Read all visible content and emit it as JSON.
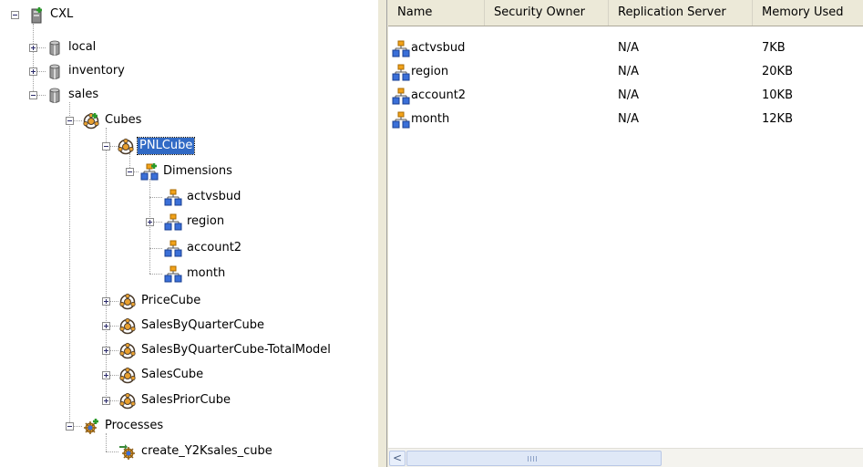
{
  "tree": {
    "server": "CXL",
    "databases": [
      {
        "label": "local",
        "expanded": false
      },
      {
        "label": "inventory",
        "expanded": false
      },
      {
        "label": "sales",
        "expanded": true
      }
    ],
    "cubes_folder": "Cubes",
    "selected_cube": "PNLCube",
    "dimensions_folder": "Dimensions",
    "dimensions": [
      "actvsbud",
      "region",
      "account2",
      "month"
    ],
    "other_cubes": [
      "PriceCube",
      "SalesByQuarterCube",
      "SalesByQuarterCube-TotalModel",
      "SalesCube",
      "SalesPriorCube"
    ],
    "processes_folder": "Processes",
    "processes": [
      "create_Y2Ksales_cube"
    ]
  },
  "list": {
    "columns": [
      "Name",
      "Security Owner",
      "Replication Server",
      "Memory Used"
    ],
    "rows": [
      {
        "name": "actvsbud",
        "security_owner": "",
        "replication_server": "N/A",
        "memory_used": "7KB"
      },
      {
        "name": "region",
        "security_owner": "",
        "replication_server": "N/A",
        "memory_used": "20KB"
      },
      {
        "name": "account2",
        "security_owner": "",
        "replication_server": "N/A",
        "memory_used": "10KB"
      },
      {
        "name": "month",
        "security_owner": "",
        "replication_server": "N/A",
        "memory_used": "12KB"
      }
    ]
  },
  "scrollbar": {
    "left_arrow": "<"
  },
  "colors": {
    "selection": "#316ac5",
    "dimension_icon": "#f2a21a",
    "dimension_boxes": "#3a6fd8",
    "cube_icon": "#e8a030"
  }
}
